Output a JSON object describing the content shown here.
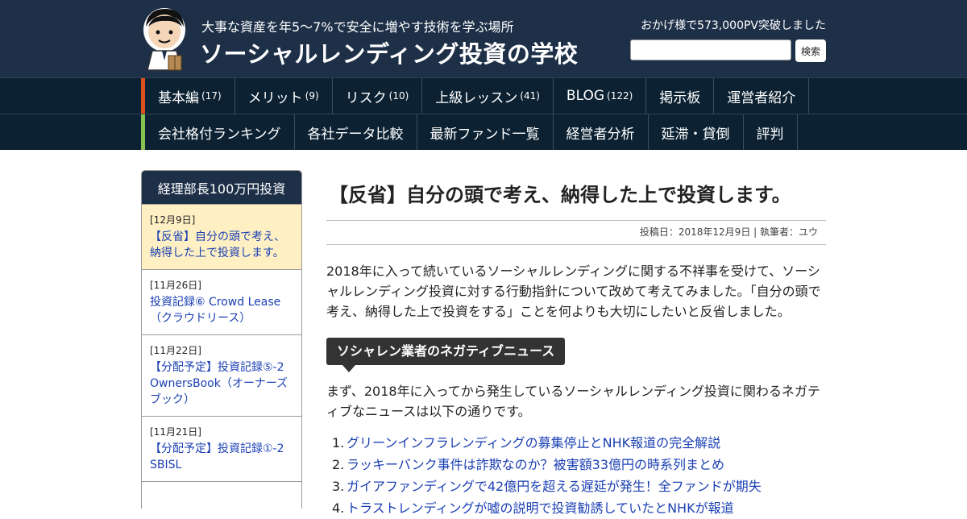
{
  "header": {
    "tagline": "大事な資産を年5～7%で安全に増やす技術を学ぶ場所",
    "site_title": "ソーシャルレンディング投資の学校",
    "pv_text": "おかげ様で573,000PV突破しました",
    "search_value": "",
    "search_button": "検索"
  },
  "nav": {
    "row1": [
      {
        "label": "基本編",
        "count": "(17)"
      },
      {
        "label": "メリット",
        "count": "(9)"
      },
      {
        "label": "リスク",
        "count": "(10)"
      },
      {
        "label": "上級レッスン",
        "count": "(41)"
      },
      {
        "label": "BLOG",
        "count": "(122)"
      },
      {
        "label": "掲示板",
        "count": ""
      },
      {
        "label": "運営者紹介",
        "count": ""
      }
    ],
    "row2": [
      {
        "label": "会社格付ランキング"
      },
      {
        "label": "各社データ比較"
      },
      {
        "label": "最新ファンド一覧"
      },
      {
        "label": "経営者分析"
      },
      {
        "label": "延滞・貸倒"
      },
      {
        "label": "評判"
      }
    ]
  },
  "sidebar": {
    "title": "経理部長100万円投資",
    "items": [
      {
        "date": "[12月9日]",
        "title": "【反省】自分の頭で考え、納得した上で投資します。",
        "active": true
      },
      {
        "date": "[11月26日]",
        "title": "投資記録⑥ Crowd Lease（クラウドリース）",
        "active": false
      },
      {
        "date": "[11月22日]",
        "title": "【分配予定】投資記録⑤-2 OwnersBook（オーナーズブック）",
        "active": false
      },
      {
        "date": "[11月21日]",
        "title": "【分配予定】投資記録①-2 SBISL",
        "active": false
      }
    ]
  },
  "article": {
    "title": "【反省】自分の頭で考え、納得した上で投資します。",
    "meta": "投稿日：2018年12月9日 | 執筆者：ユウ",
    "intro": "2018年に入って続いているソーシャルレンディングに関する不祥事を受けて、ソーシャルレンディング投資に対する行動指針について改めて考えてみました。「自分の頭で考え、納得した上で投資をする」ことを何よりも大切にしたいと反省しました。",
    "section_heading": "ソシャレン業者のネガティブニュース",
    "section_text": "まず、2018年に入ってから発生しているソーシャルレンディング投資に関わるネガティブなニュースは以下の通りです。",
    "links": [
      {
        "num": "1.",
        "text": "グリーンインフラレンディングの募集停止とNHK報道の完全解説"
      },
      {
        "num": "2.",
        "text": "ラッキーバンク事件は詐欺なのか？被害額33億円の時系列まとめ"
      },
      {
        "num": "3.",
        "text": "ガイアファンディングで42億円を超える遅延が発生！全ファンドが期失"
      },
      {
        "num": "4.",
        "text": "トラストレンディングが嘘の説明で投資勧誘していたとNHKが報道"
      }
    ]
  },
  "colors": {
    "header_bg": "#1e3048",
    "nav_bg": "#0c2233",
    "nav_accent_row1": "#e0501e",
    "nav_accent_row2": "#88c253",
    "link": "#1a3fb3",
    "sidebar_active_bg": "#fff0c4"
  },
  "icons": {
    "logo": "cartoon-student-mascot"
  }
}
